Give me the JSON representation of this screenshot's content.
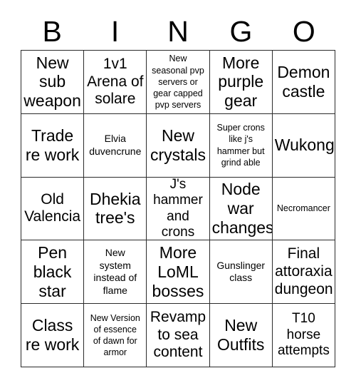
{
  "card": {
    "header_letters": [
      "B",
      "I",
      "N",
      "G",
      "O"
    ],
    "columns": 5,
    "rows": 5,
    "border_color": "#2b2b2b",
    "background_color": "#ffffff",
    "text_color": "#000000",
    "cells": [
      {
        "text": "New\nsub\nweapon",
        "size": "xl"
      },
      {
        "text": "1v1\nArena of\nsolare",
        "size": "lg"
      },
      {
        "text": "New\nseasonal pvp\nservers or\ngear capped\npvp servers",
        "size": "xs"
      },
      {
        "text": "More\npurple\ngear",
        "size": "xl"
      },
      {
        "text": "Demon\ncastle",
        "size": "xl"
      },
      {
        "text": "Trade\nre work",
        "size": "xl"
      },
      {
        "text": "Elvia\nduvencrune",
        "size": "sm"
      },
      {
        "text": "New\ncrystals",
        "size": "xl"
      },
      {
        "text": "Super crons\nlike j's\nhammer but\ngrind able",
        "size": "xs"
      },
      {
        "text": "Wukong",
        "size": "xl"
      },
      {
        "text": "Old\nValencia",
        "size": "lg"
      },
      {
        "text": "Dhekia\ntree's",
        "size": "xl"
      },
      {
        "text": "J's\nhammer\nand crons",
        "size": "md"
      },
      {
        "text": "Node\nwar\nchanges",
        "size": "xl"
      },
      {
        "text": "Necromancer",
        "size": "xs"
      },
      {
        "text": "Pen\nblack\nstar",
        "size": "xl"
      },
      {
        "text": "New\nsystem\ninstead of\nflame",
        "size": "sm"
      },
      {
        "text": "More\nLoML\nbosses",
        "size": "xl"
      },
      {
        "text": "Gunslinger\nclass",
        "size": "sm"
      },
      {
        "text": "Final\nattoraxia\ndungeon",
        "size": "lg"
      },
      {
        "text": "Class\nre work",
        "size": "xl"
      },
      {
        "text": "New Version\nof essence\nof dawn for\narmor",
        "size": "xs"
      },
      {
        "text": "Revamp\nto sea\ncontent",
        "size": "lg"
      },
      {
        "text": "New\nOutfits",
        "size": "xl"
      },
      {
        "text": "T10\nhorse\nattempts",
        "size": "md"
      }
    ]
  }
}
